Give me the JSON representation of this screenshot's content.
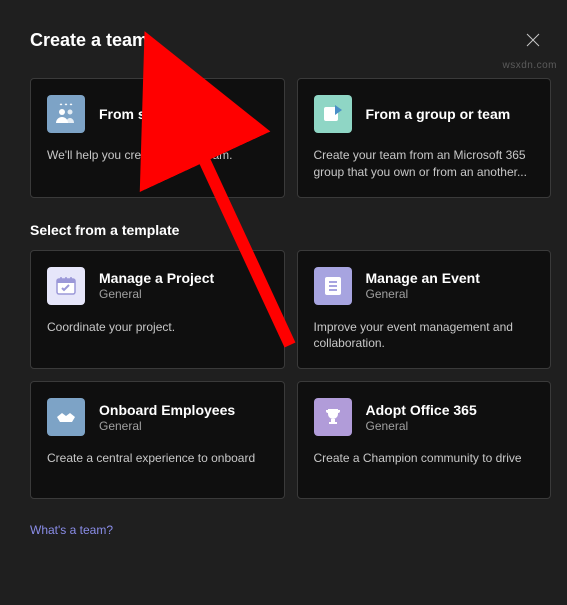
{
  "dialog": {
    "title": "Create a team",
    "close_label": "Close"
  },
  "options": {
    "from_scratch": {
      "title": "From scratch",
      "desc": "We'll help you create a basic team."
    },
    "from_group": {
      "title": "From a group or team",
      "desc": "Create your team from an Microsoft 365 group that you own or from an another..."
    }
  },
  "templates": {
    "section_title": "Select from a template",
    "manage_project": {
      "title": "Manage a Project",
      "sub": "General",
      "desc": "Coordinate your project."
    },
    "manage_event": {
      "title": "Manage an Event",
      "sub": "General",
      "desc": "Improve your event management and collaboration."
    },
    "onboard": {
      "title": "Onboard Employees",
      "sub": "General",
      "desc": "Create a central experience to onboard"
    },
    "adopt": {
      "title": "Adopt Office 365",
      "sub": "General",
      "desc": "Create a Champion community to drive"
    }
  },
  "footer": {
    "whats_a_team": "What's a team?"
  },
  "watermark": "wsxdn.com"
}
